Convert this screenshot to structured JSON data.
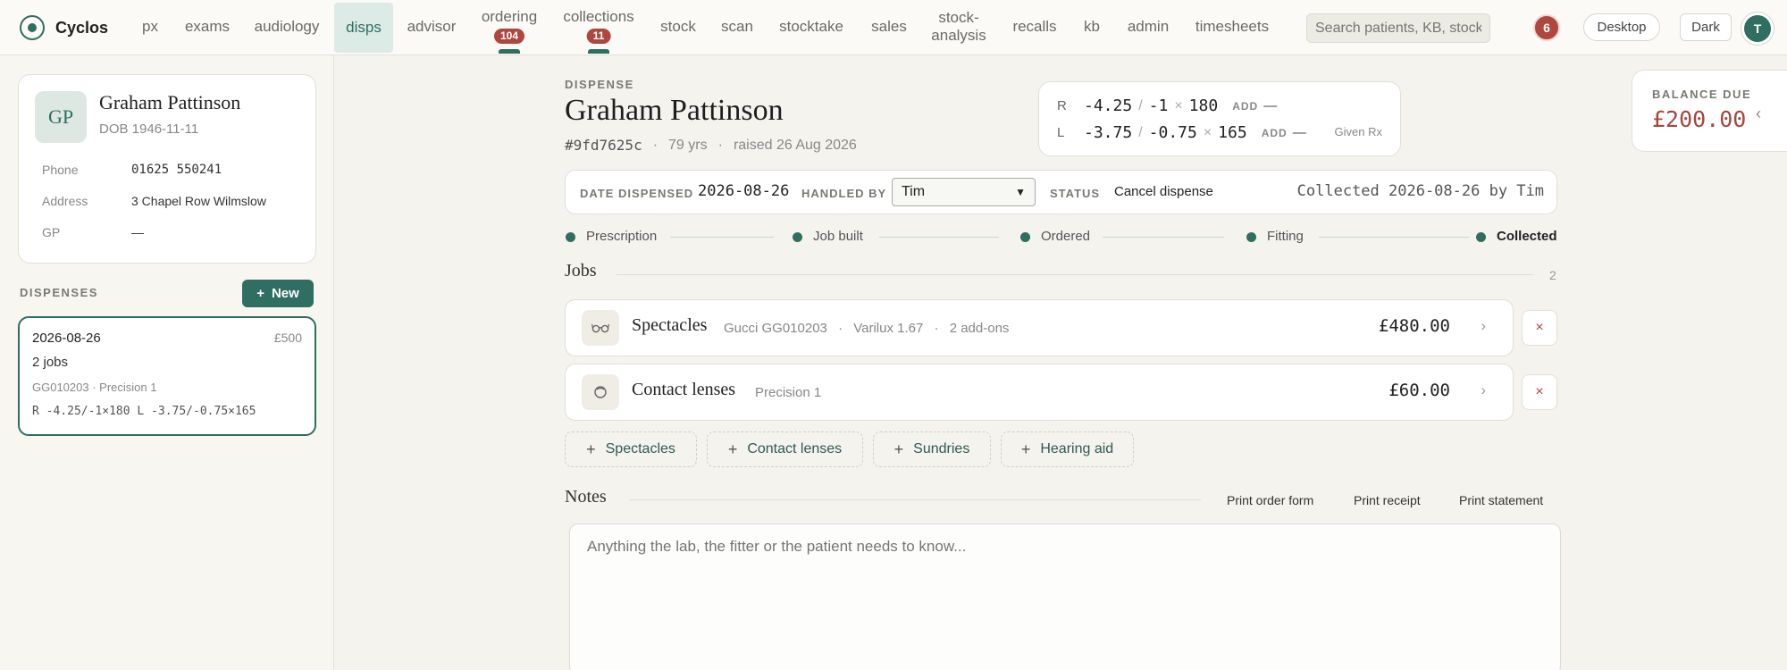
{
  "app": {
    "name": "Cyclos"
  },
  "nav": {
    "items": [
      {
        "label": "px"
      },
      {
        "label": "exams"
      },
      {
        "label": "audiology"
      },
      {
        "label": "disps"
      },
      {
        "label": "advisor"
      },
      {
        "label": "ordering",
        "badge": "104"
      },
      {
        "label": "collections",
        "badge": "11"
      },
      {
        "label": "stock"
      },
      {
        "label": "scan"
      },
      {
        "label": "stocktake"
      },
      {
        "label": "sales"
      },
      {
        "label": "stock-analysis"
      },
      {
        "label": "recalls"
      },
      {
        "label": "kb"
      },
      {
        "label": "admin"
      },
      {
        "label": "timesheets"
      }
    ],
    "search_placeholder": "Search patients, KB, stock",
    "notification_count": "6",
    "desktop_label": "Desktop",
    "dark_label": "Dark",
    "user_initial": "T"
  },
  "patient": {
    "initials": "GP",
    "name": "Graham Pattinson",
    "dob": "DOB 1946-11-11",
    "phone_label": "Phone",
    "phone": "01625 550241",
    "address_label": "Address",
    "address": "3 Chapel Row Wilmslow",
    "gp_label": "GP",
    "gp": "—"
  },
  "dispenses": {
    "section_label": "DISPENSES",
    "new_label": "New",
    "items": [
      {
        "date": "2026-08-26",
        "amount": "£500",
        "jobs": "2 jobs",
        "frame": "GG010203 · Precision 1",
        "rx": "R -4.25/-1×180 L -3.75/-0.75×165"
      }
    ]
  },
  "dispense": {
    "eyebrow": "DISPENSE",
    "patient_name": "Graham Pattinson",
    "id": "#9fd7625c",
    "age": "79 yrs",
    "raised": "raised 26 Aug 2026",
    "date_label": "DATE DISPENSED",
    "date": "2026-08-26",
    "handled_label": "HANDLED BY",
    "handled_by": "Tim",
    "status_label": "STATUS",
    "cancel_label": "Cancel dispense",
    "collected_text": "Collected 2026-08-26 by Tim"
  },
  "rx": {
    "right": {
      "eye": "R",
      "sph": "-4.25",
      "cyl": "-1",
      "axis": "180",
      "add_label": "ADD",
      "add": "—"
    },
    "left": {
      "eye": "L",
      "sph": "-3.75",
      "cyl": "-0.75",
      "axis": "165",
      "add_label": "ADD",
      "add": "—"
    },
    "note": "Given Rx"
  },
  "balance": {
    "label": "BALANCE DUE",
    "value": "£200.00"
  },
  "steps": [
    {
      "label": "Prescription"
    },
    {
      "label": "Job built"
    },
    {
      "label": "Ordered"
    },
    {
      "label": "Fitting"
    },
    {
      "label": "Collected",
      "current": true
    }
  ],
  "jobs": {
    "title": "Jobs",
    "count": "2",
    "items": [
      {
        "icon": "glasses-icon",
        "title": "Spectacles",
        "frame": "Gucci GG010203",
        "lens": "Varilux 1.67",
        "addons": "2 add-ons",
        "price": "£480.00"
      },
      {
        "icon": "contact-lens-icon",
        "title": "Contact lenses",
        "desc": "Precision 1",
        "price": "£60.00"
      }
    ],
    "add_buttons": [
      "Spectacles",
      "Contact lenses",
      "Sundries",
      "Hearing aid"
    ]
  },
  "notes": {
    "title": "Notes",
    "print_order": "Print order form",
    "print_receipt": "Print receipt",
    "print_statement": "Print statement",
    "placeholder": "Anything the lab, the fitter or the patient needs to know..."
  },
  "colors": {
    "accent": "#2f6e60",
    "danger": "#b0473f",
    "balance": "#a5463e"
  }
}
